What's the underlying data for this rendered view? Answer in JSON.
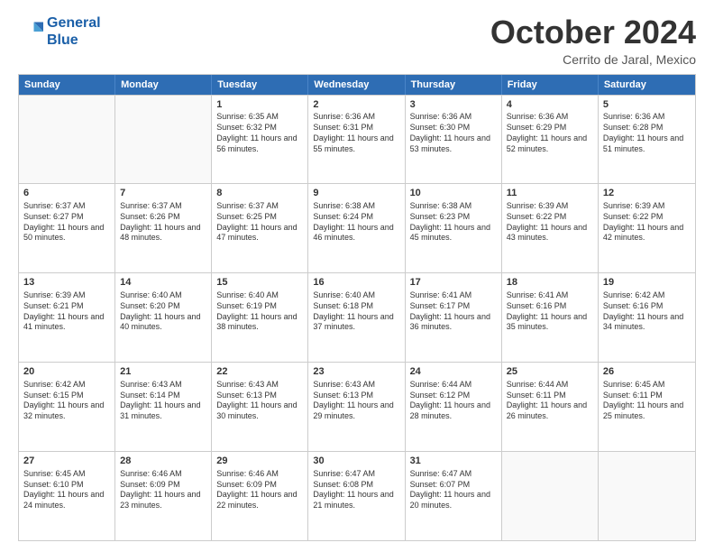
{
  "header": {
    "logo_line1": "General",
    "logo_line2": "Blue",
    "month": "October 2024",
    "location": "Cerrito de Jaral, Mexico"
  },
  "days_of_week": [
    "Sunday",
    "Monday",
    "Tuesday",
    "Wednesday",
    "Thursday",
    "Friday",
    "Saturday"
  ],
  "weeks": [
    [
      {
        "day": "",
        "info": ""
      },
      {
        "day": "",
        "info": ""
      },
      {
        "day": "1",
        "info": "Sunrise: 6:35 AM\nSunset: 6:32 PM\nDaylight: 11 hours and 56 minutes."
      },
      {
        "day": "2",
        "info": "Sunrise: 6:36 AM\nSunset: 6:31 PM\nDaylight: 11 hours and 55 minutes."
      },
      {
        "day": "3",
        "info": "Sunrise: 6:36 AM\nSunset: 6:30 PM\nDaylight: 11 hours and 53 minutes."
      },
      {
        "day": "4",
        "info": "Sunrise: 6:36 AM\nSunset: 6:29 PM\nDaylight: 11 hours and 52 minutes."
      },
      {
        "day": "5",
        "info": "Sunrise: 6:36 AM\nSunset: 6:28 PM\nDaylight: 11 hours and 51 minutes."
      }
    ],
    [
      {
        "day": "6",
        "info": "Sunrise: 6:37 AM\nSunset: 6:27 PM\nDaylight: 11 hours and 50 minutes."
      },
      {
        "day": "7",
        "info": "Sunrise: 6:37 AM\nSunset: 6:26 PM\nDaylight: 11 hours and 48 minutes."
      },
      {
        "day": "8",
        "info": "Sunrise: 6:37 AM\nSunset: 6:25 PM\nDaylight: 11 hours and 47 minutes."
      },
      {
        "day": "9",
        "info": "Sunrise: 6:38 AM\nSunset: 6:24 PM\nDaylight: 11 hours and 46 minutes."
      },
      {
        "day": "10",
        "info": "Sunrise: 6:38 AM\nSunset: 6:23 PM\nDaylight: 11 hours and 45 minutes."
      },
      {
        "day": "11",
        "info": "Sunrise: 6:39 AM\nSunset: 6:22 PM\nDaylight: 11 hours and 43 minutes."
      },
      {
        "day": "12",
        "info": "Sunrise: 6:39 AM\nSunset: 6:22 PM\nDaylight: 11 hours and 42 minutes."
      }
    ],
    [
      {
        "day": "13",
        "info": "Sunrise: 6:39 AM\nSunset: 6:21 PM\nDaylight: 11 hours and 41 minutes."
      },
      {
        "day": "14",
        "info": "Sunrise: 6:40 AM\nSunset: 6:20 PM\nDaylight: 11 hours and 40 minutes."
      },
      {
        "day": "15",
        "info": "Sunrise: 6:40 AM\nSunset: 6:19 PM\nDaylight: 11 hours and 38 minutes."
      },
      {
        "day": "16",
        "info": "Sunrise: 6:40 AM\nSunset: 6:18 PM\nDaylight: 11 hours and 37 minutes."
      },
      {
        "day": "17",
        "info": "Sunrise: 6:41 AM\nSunset: 6:17 PM\nDaylight: 11 hours and 36 minutes."
      },
      {
        "day": "18",
        "info": "Sunrise: 6:41 AM\nSunset: 6:16 PM\nDaylight: 11 hours and 35 minutes."
      },
      {
        "day": "19",
        "info": "Sunrise: 6:42 AM\nSunset: 6:16 PM\nDaylight: 11 hours and 34 minutes."
      }
    ],
    [
      {
        "day": "20",
        "info": "Sunrise: 6:42 AM\nSunset: 6:15 PM\nDaylight: 11 hours and 32 minutes."
      },
      {
        "day": "21",
        "info": "Sunrise: 6:43 AM\nSunset: 6:14 PM\nDaylight: 11 hours and 31 minutes."
      },
      {
        "day": "22",
        "info": "Sunrise: 6:43 AM\nSunset: 6:13 PM\nDaylight: 11 hours and 30 minutes."
      },
      {
        "day": "23",
        "info": "Sunrise: 6:43 AM\nSunset: 6:13 PM\nDaylight: 11 hours and 29 minutes."
      },
      {
        "day": "24",
        "info": "Sunrise: 6:44 AM\nSunset: 6:12 PM\nDaylight: 11 hours and 28 minutes."
      },
      {
        "day": "25",
        "info": "Sunrise: 6:44 AM\nSunset: 6:11 PM\nDaylight: 11 hours and 26 minutes."
      },
      {
        "day": "26",
        "info": "Sunrise: 6:45 AM\nSunset: 6:11 PM\nDaylight: 11 hours and 25 minutes."
      }
    ],
    [
      {
        "day": "27",
        "info": "Sunrise: 6:45 AM\nSunset: 6:10 PM\nDaylight: 11 hours and 24 minutes."
      },
      {
        "day": "28",
        "info": "Sunrise: 6:46 AM\nSunset: 6:09 PM\nDaylight: 11 hours and 23 minutes."
      },
      {
        "day": "29",
        "info": "Sunrise: 6:46 AM\nSunset: 6:09 PM\nDaylight: 11 hours and 22 minutes."
      },
      {
        "day": "30",
        "info": "Sunrise: 6:47 AM\nSunset: 6:08 PM\nDaylight: 11 hours and 21 minutes."
      },
      {
        "day": "31",
        "info": "Sunrise: 6:47 AM\nSunset: 6:07 PM\nDaylight: 11 hours and 20 minutes."
      },
      {
        "day": "",
        "info": ""
      },
      {
        "day": "",
        "info": ""
      }
    ]
  ]
}
